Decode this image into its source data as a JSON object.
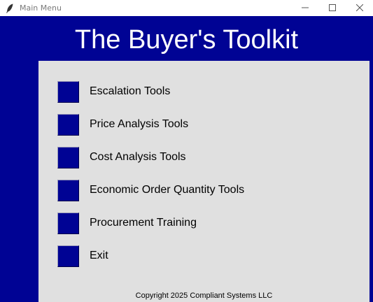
{
  "window": {
    "title": "Main Menu",
    "icon": "feather-icon",
    "controls": [
      "minimize-icon",
      "maximize-icon",
      "close-icon"
    ]
  },
  "header": {
    "title": "The Buyer's Toolkit"
  },
  "menu": {
    "items": [
      {
        "label": "Escalation Tools"
      },
      {
        "label": "Price Analysis Tools"
      },
      {
        "label": "Cost Analysis Tools"
      },
      {
        "label": "Economic Order Quantity Tools"
      },
      {
        "label": "Procurement Training"
      },
      {
        "label": "Exit"
      }
    ]
  },
  "footer": {
    "copyright": "Copyright 2025 Compliant Systems LLC"
  },
  "colors": {
    "brand_blue": "#000394",
    "panel_gray": "#e0e0e0"
  }
}
